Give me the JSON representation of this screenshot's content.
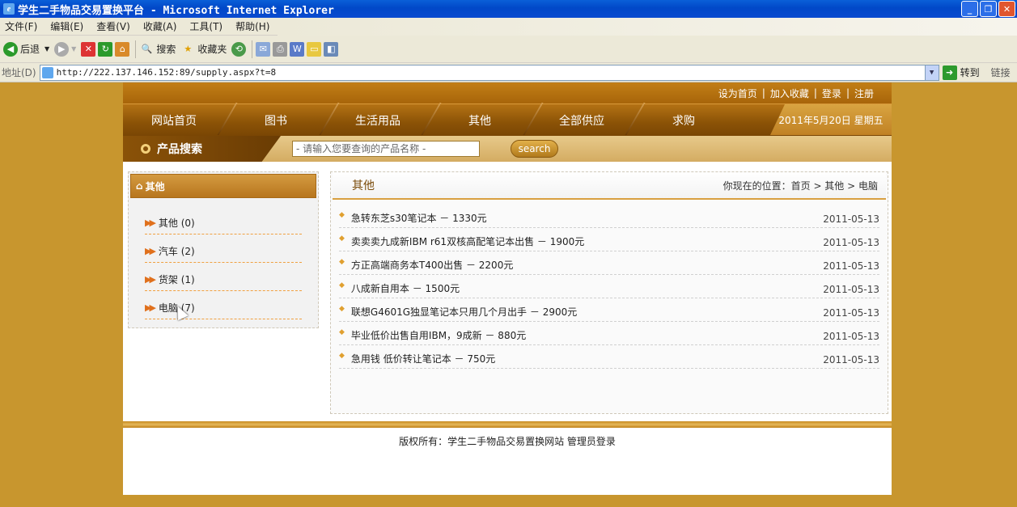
{
  "window": {
    "title": "学生二手物品交易置换平台 - Microsoft Internet Explorer"
  },
  "menu": [
    "文件(F)",
    "编辑(E)",
    "查看(V)",
    "收藏(A)",
    "工具(T)",
    "帮助(H)"
  ],
  "toolbar": {
    "back": "后退",
    "search": "搜索",
    "favorites": "收藏夹"
  },
  "address": {
    "label": "地址(D)",
    "url": "http://222.137.146.152:89/supply.aspx?t=8",
    "go": "转到",
    "links": "链接"
  },
  "site": {
    "top_links": [
      "设为首页",
      "|",
      "加入收藏",
      "|",
      "登录",
      "|",
      "注册"
    ],
    "nav": [
      "网站首页",
      "图书",
      "生活用品",
      "其他",
      "全部供应",
      "求购"
    ],
    "date": "2011年5月20日 星期五",
    "search": {
      "title": "产品搜索",
      "placeholder": "- 请输入您要查询的产品名称 -",
      "button": "search"
    },
    "sidebar": {
      "title": "其他",
      "items": [
        {
          "label": "其他 (0)"
        },
        {
          "label": "汽车 (2)"
        },
        {
          "label": "货架 (1)"
        },
        {
          "label": "电脑 (7)"
        }
      ]
    },
    "main": {
      "title": "其他",
      "breadcrumb": "你现在的位置：首页 > 其他 > 电脑",
      "items": [
        {
          "text": "急转东芝s30笔记本 － 1330元",
          "date": "2011-05-13"
        },
        {
          "text": "卖卖卖九成新IBM r61双核高配笔记本出售 － 1900元",
          "date": "2011-05-13"
        },
        {
          "text": "方正高端商务本T400出售 － 2200元",
          "date": "2011-05-13"
        },
        {
          "text": "八成新自用本 － 1500元",
          "date": "2011-05-13"
        },
        {
          "text": "联想G4601G独显笔记本只用几个月出手 － 2900元",
          "date": "2011-05-13"
        },
        {
          "text": "毕业低价出售自用IBM，9成新 － 880元",
          "date": "2011-05-13"
        },
        {
          "text": "急用钱 低价转让笔记本 － 750元",
          "date": "2011-05-13"
        }
      ]
    },
    "footer": "版权所有：学生二手物品交易置换网站 管理员登录"
  }
}
